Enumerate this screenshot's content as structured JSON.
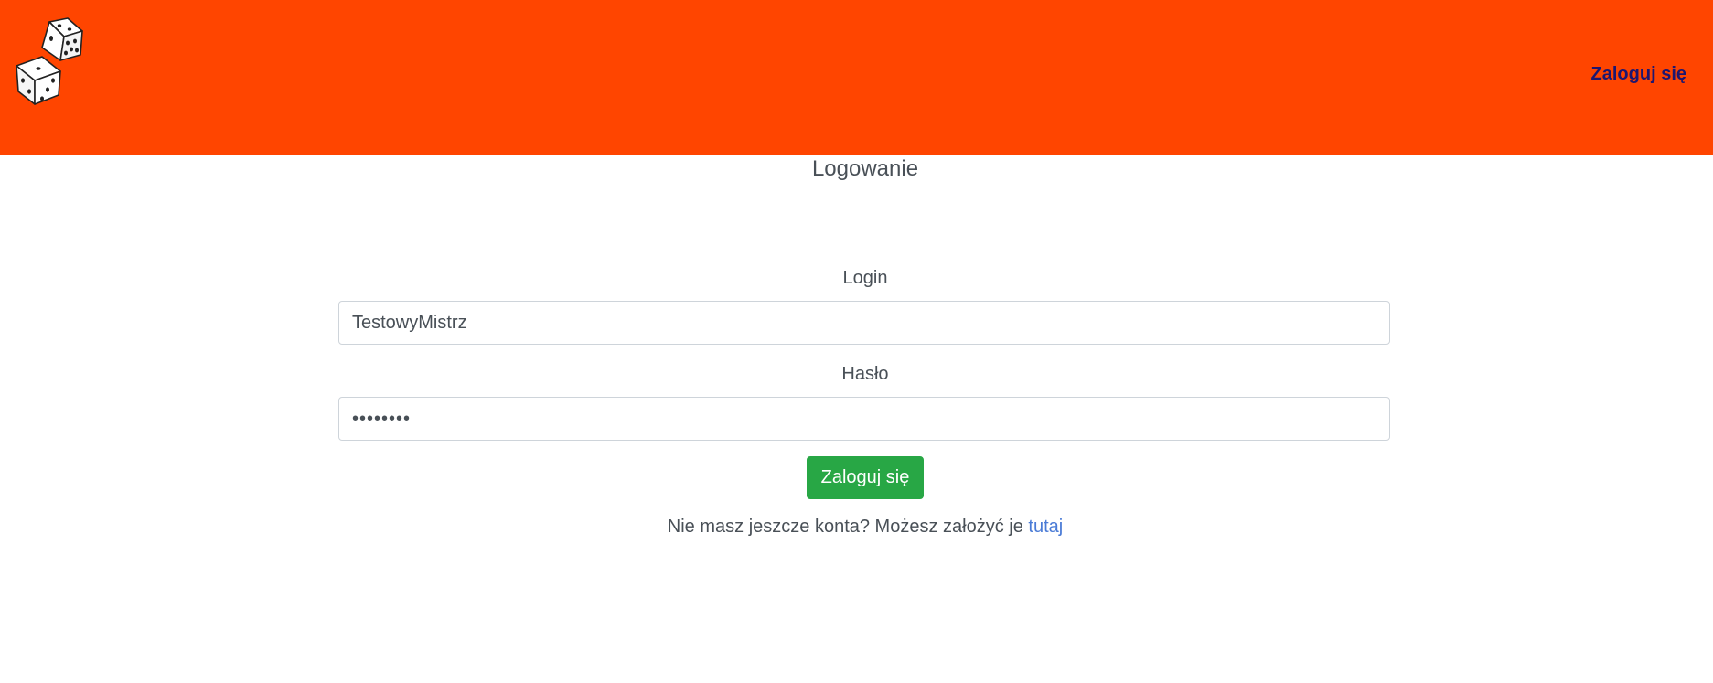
{
  "header": {
    "logo": "dice-logo",
    "nav_login_label": "Zaloguj się",
    "background_color": "#ff4500"
  },
  "main": {
    "title": "Logowanie",
    "login_label": "Login",
    "login_value": "TestowyMistrz",
    "password_label": "Hasło",
    "password_value": "••••••••",
    "submit_label": "Zaloguj się",
    "register_text": "Nie masz jeszcze konta? Możesz założyć je ",
    "register_link_label": "tutaj"
  },
  "colors": {
    "accent": "#ff4500",
    "button": "#28a745",
    "link": "#4a7bd6",
    "nav_link": "#1e1670"
  }
}
